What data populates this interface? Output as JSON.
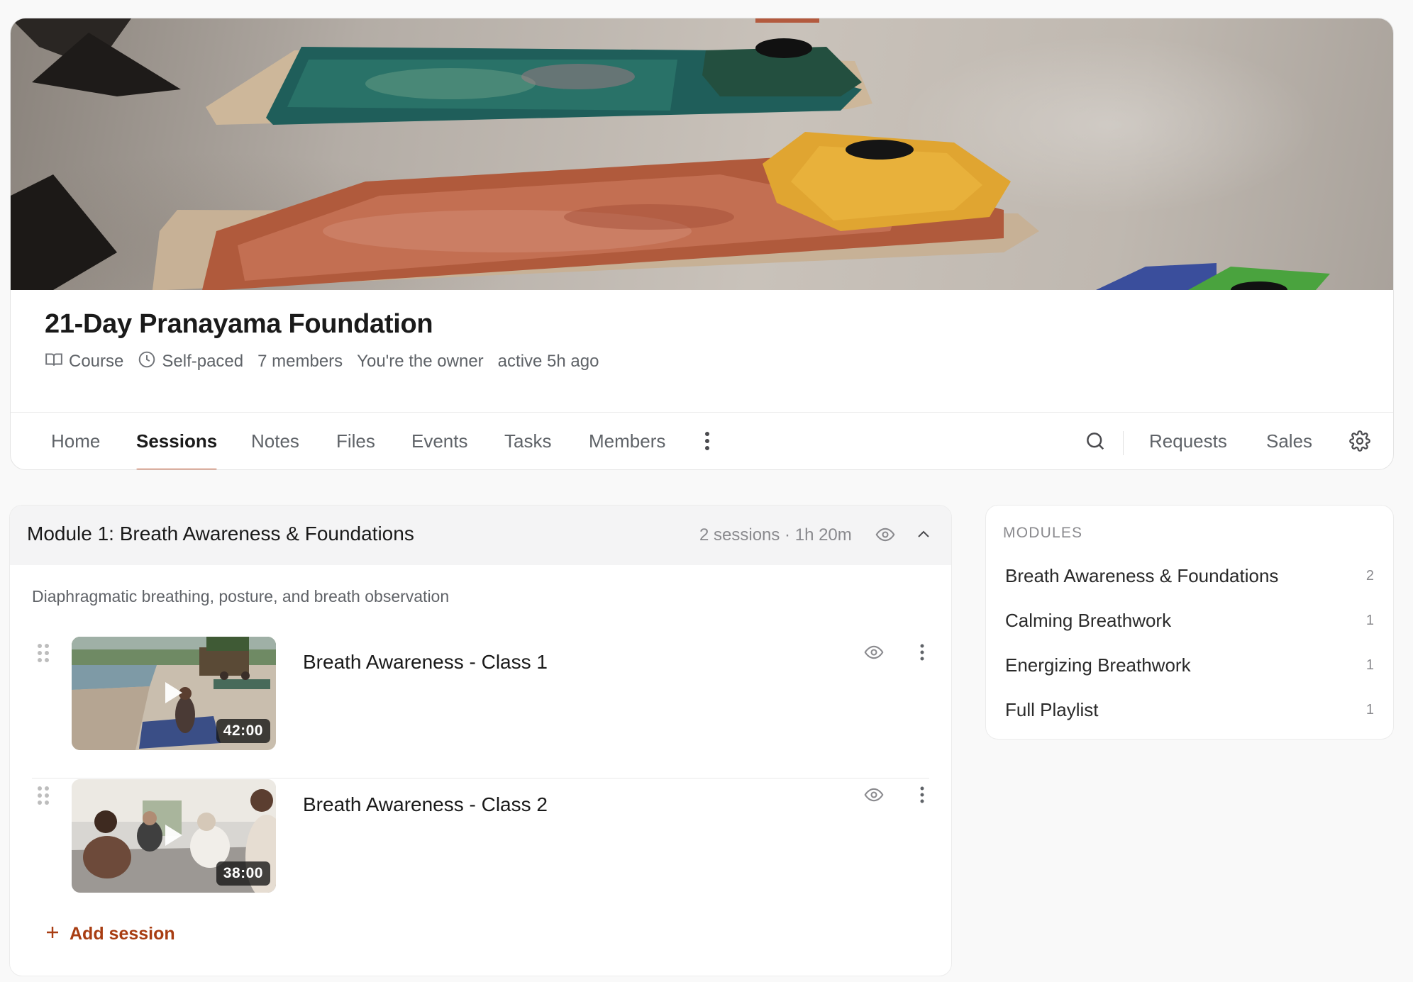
{
  "course": {
    "title": "21-Day Pranayama Foundation",
    "type_label": "Course",
    "pace_label": "Self-paced",
    "members_label": "7 members",
    "owner_label": "You're the owner",
    "activity_label": "active 5h ago"
  },
  "tabs": {
    "home": "Home",
    "sessions": "Sessions",
    "notes": "Notes",
    "files": "Files",
    "events": "Events",
    "tasks": "Tasks",
    "members": "Members",
    "requests": "Requests",
    "sales": "Sales",
    "active": "Sessions"
  },
  "module": {
    "title": "Module 1: Breath Awareness & Foundations",
    "stats": "2 sessions · 1h 20m",
    "description": "Diaphragmatic breathing, posture, and breath observation",
    "sessions": [
      {
        "title": "Breath Awareness - Class 1",
        "duration": "42:00"
      },
      {
        "title": "Breath Awareness - Class 2",
        "duration": "38:00"
      }
    ],
    "add_label": "Add session"
  },
  "sidebar": {
    "heading": "MODULES",
    "items": [
      {
        "label": "Breath Awareness & Foundations",
        "count": "2"
      },
      {
        "label": "Calming Breathwork",
        "count": "1"
      },
      {
        "label": "Energizing Breathwork",
        "count": "1"
      },
      {
        "label": "Full Playlist",
        "count": "1"
      }
    ]
  },
  "colors": {
    "accent": "#b8441a",
    "add_link": "#a83d12",
    "muted_text": "#5f6368"
  },
  "icons": [
    "book-icon",
    "clock-icon",
    "more-vertical-icon",
    "search-icon",
    "gear-icon",
    "eye-icon",
    "chevron-up-icon",
    "drag-handle-icon",
    "play-icon",
    "plus-icon"
  ]
}
